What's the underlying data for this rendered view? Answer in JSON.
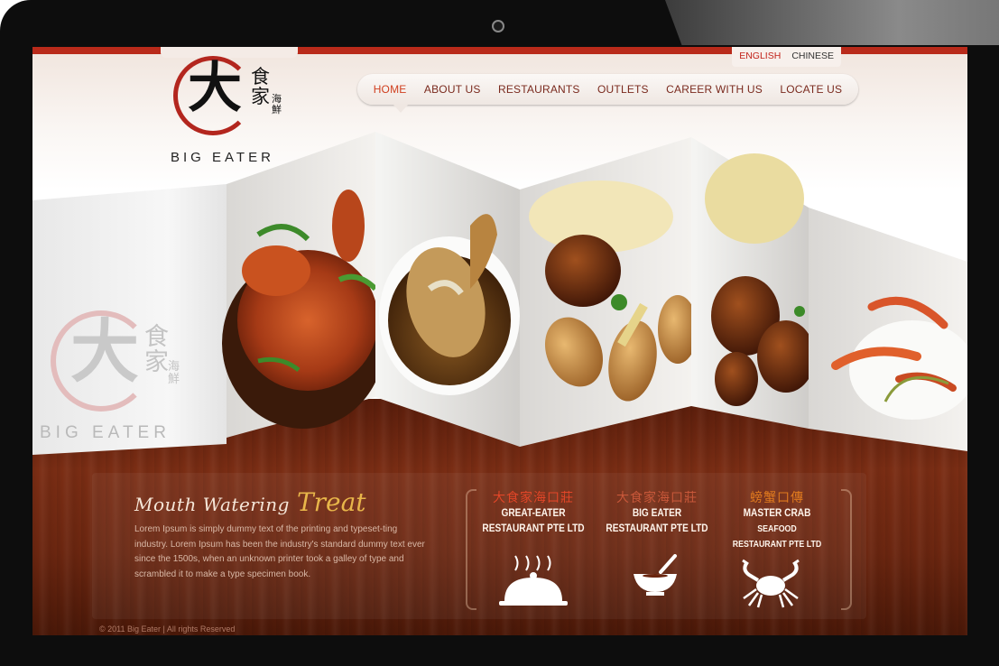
{
  "site": {
    "logo_chars": {
      "big": "大",
      "small": "食家",
      "tiny": "海鮮"
    },
    "logo_name": "BIG EATER",
    "language": {
      "active": "ENGLISH",
      "other": "CHINESE"
    }
  },
  "nav": {
    "items": [
      {
        "label": "HOME",
        "current": true
      },
      {
        "label": "ABOUT US"
      },
      {
        "label": "RESTAURANTS"
      },
      {
        "label": "OUTLETS"
      },
      {
        "label": "CAREER WITH US"
      },
      {
        "label": "LOCATE US"
      }
    ]
  },
  "hero": {
    "watermark": {
      "big": "大",
      "small": "食家",
      "tiny": "海鮮",
      "name": "BIG EATER"
    },
    "panels": [
      "crab-dish",
      "fish-dish",
      "fried-rolls-dish",
      "pork-ribs-dish",
      "prawn-dish"
    ]
  },
  "promo": {
    "tag_a": "Mouth Watering",
    "tag_b": "Treat",
    "body": "Lorem Ipsum is simply dummy text of the printing and typeset-ting industry. Lorem Ipsum has been the industry's standard dummy text ever since the 1500s, when an unknown printer took a galley of type and scrambled it to make a type specimen book."
  },
  "brands": [
    {
      "cn": "大食家海口莊",
      "en_1": "GREAT-EATER",
      "en_2": "RESTAURANT PTE LTD",
      "icon": "cloche-icon"
    },
    {
      "cn": "大食家海口莊",
      "en_1": "BIG EATER",
      "en_2": "RESTAURANT PTE LTD",
      "icon": "soup-bowl-icon"
    },
    {
      "cn": "螃蟹口傳",
      "en_1": "MASTER  CRAB",
      "en_2": "SEAFOOD",
      "en_3": "RESTAURANT  PTE  LTD",
      "icon": "crab-icon"
    }
  ],
  "footer": {
    "text": "© 2011 Big Eater   |  All rights Reserved"
  },
  "colors": {
    "accent": "#b92a1a",
    "wood": "#6b2610",
    "gold": "#e8b64a"
  }
}
